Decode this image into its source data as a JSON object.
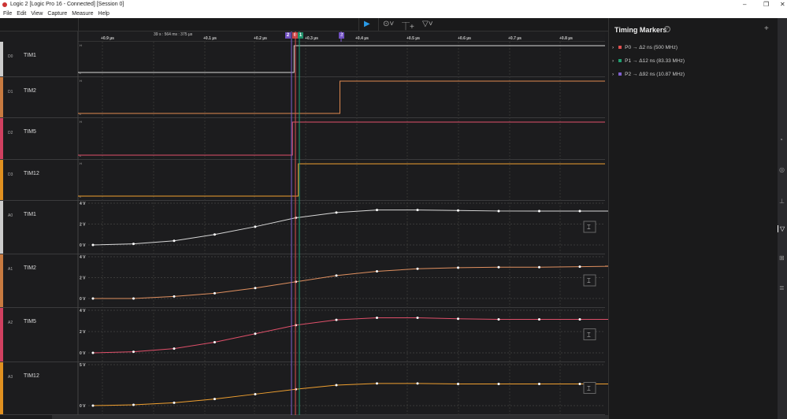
{
  "window": {
    "title": "Logic 2 [Logic Pro 16 - Connected] [Session 0]"
  },
  "menu": [
    "File",
    "Edit",
    "View",
    "Capture",
    "Measure",
    "Help"
  ],
  "toolbar": {
    "play_icon": "play-icon",
    "timer_icon": "timer-icon",
    "trigger_icon": "trigger-icon",
    "marker_icon": "marker-icon"
  },
  "ruler": {
    "timestamp": "39 s : 564 ms : 375 µs",
    "ticks": [
      "+0.9 µs",
      "+0.1 µs",
      "+0.2 µs",
      "+0.3 µs",
      "+0.4 µs",
      "+0.5 µs",
      "+0.6 µs",
      "+0.7 µs",
      "+0.8 µs"
    ],
    "markers": [
      "2",
      "0",
      "1",
      "2"
    ]
  },
  "colors": {
    "D0": "#d8d8d8",
    "D1": "#e08a50",
    "D2": "#e0506a",
    "D3": "#f0a030",
    "A0": "#d8d8d8",
    "A1": "#e09060",
    "A2": "#e0506a",
    "A3": "#f0a030",
    "P0": "#e05050",
    "P1": "#20a070",
    "P2": "#8060d0"
  },
  "channels": [
    {
      "id": "D0",
      "name": "TIM1",
      "type": "digital",
      "levels": [
        "H",
        "L"
      ],
      "edges": [
        0.41
      ],
      "start": 0
    },
    {
      "id": "D1",
      "name": "TIM2",
      "type": "digital",
      "levels": [
        "H",
        "L"
      ],
      "edges": [
        0.497
      ],
      "start": 0
    },
    {
      "id": "D2",
      "name": "TIM5",
      "type": "digital",
      "levels": [
        "H",
        "L"
      ],
      "edges": [
        0.407
      ],
      "start": 0
    },
    {
      "id": "D3",
      "name": "TIM12",
      "type": "digital",
      "levels": [
        "H",
        "L"
      ],
      "edges": [
        0.418
      ],
      "start": 0
    },
    {
      "id": "A0",
      "name": "TIM1",
      "type": "analog",
      "axis": [
        "4 V",
        "2 V",
        "0 V"
      ],
      "max": 4,
      "values": [
        0,
        0.1,
        0.4,
        1.0,
        1.75,
        2.6,
        3.1,
        3.35,
        3.35,
        3.3,
        3.25,
        3.25,
        3.25,
        3.25
      ]
    },
    {
      "id": "A1",
      "name": "TIM2",
      "type": "analog",
      "axis": [
        "4 V",
        "2 V",
        "0 V"
      ],
      "max": 4,
      "values": [
        0,
        0,
        0.2,
        0.5,
        1.0,
        1.6,
        2.2,
        2.6,
        2.85,
        2.95,
        3.0,
        3.0,
        3.05,
        3.1
      ]
    },
    {
      "id": "A2",
      "name": "TIM5",
      "type": "analog",
      "axis": [
        "4 V",
        "2 V",
        "0 V"
      ],
      "max": 4,
      "values": [
        0,
        0.1,
        0.4,
        1.0,
        1.8,
        2.6,
        3.1,
        3.3,
        3.3,
        3.2,
        3.15,
        3.15,
        3.15,
        3.15
      ]
    },
    {
      "id": "A3",
      "name": "TIM12",
      "type": "analog",
      "axis": [
        "5 V",
        "0 V"
      ],
      "max": 5,
      "values": [
        0,
        0.1,
        0.35,
        0.8,
        1.4,
        2.0,
        2.5,
        2.7,
        2.7,
        2.65,
        2.65,
        2.65,
        2.65,
        2.65
      ]
    }
  ],
  "timing_markers": {
    "title": "Timing Markers",
    "items": [
      {
        "name": "P0",
        "value": "Δ2 ns (500 MHz)",
        "color": "#e05050"
      },
      {
        "name": "P1",
        "value": "Δ12 ns (83.33 MHz)",
        "color": "#20a070"
      },
      {
        "name": "P2",
        "value": "Δ92 ns (10.87 MHz)",
        "color": "#8060d0"
      }
    ]
  }
}
